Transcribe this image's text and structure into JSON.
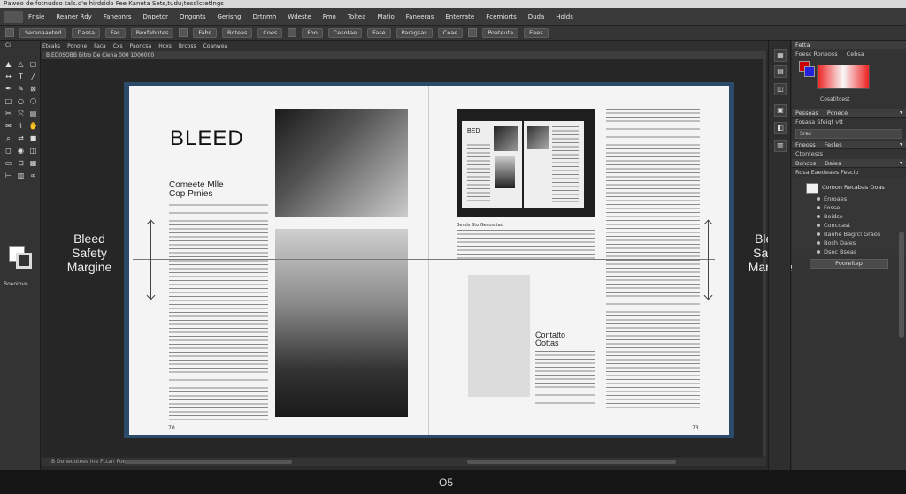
{
  "window": {
    "title": "Pаweo de fotnudso tals.o'e hirdsido Fee Kaneta Sets,tudu;tesdlctetlngs"
  },
  "menu": {
    "items": [
      "Fnsie",
      "Reaner Rdy",
      "Faneonrs",
      "Dnpetor",
      "Ongonts",
      "Gerisng",
      "Drtnmh",
      "Wdeste",
      "Fmo",
      "Toltea",
      "Matio",
      "Faneeras",
      "Enterrate",
      "Fcemiorts",
      "Duda",
      "Holds"
    ]
  },
  "options_bar": {
    "buttons": [
      "Serenaaeted",
      "Dassa",
      "Fas",
      "Bexfabntes",
      "Fabs",
      "Boteas",
      "Coes",
      "Foo",
      "Cesotae",
      "Fase",
      "Paregsas",
      "Ceae",
      "Poateuta",
      "Eees"
    ]
  },
  "control_bar": {
    "items": [
      "Eteaks",
      "Ponone",
      "Faca",
      "Cxs",
      "Paoncsa",
      "Hoxs",
      "Brcoss",
      "Coanwea"
    ]
  },
  "document_tab": {
    "label": "B ED0SOBB Bitro De Ciena 000 1000000"
  },
  "toolbox": {
    "top_label": "Ci",
    "bottom_label": "Boeoiove",
    "tool_icons": [
      "select-icon",
      "direct-select-icon",
      "page-icon",
      "gap-icon",
      "type-icon",
      "line-icon",
      "pen-icon",
      "pencil-icon",
      "frame-rect-icon",
      "rectangle-icon",
      "ellipse-icon",
      "polygon-icon",
      "scissors-icon",
      "transform-icon",
      "gradient-icon",
      "note-icon",
      "eyedropper-icon",
      "hand-icon",
      "zoom-icon",
      "swap-icon",
      "fill-icon",
      "stroke-icon",
      "preview-icon",
      "bleed-icon",
      "slug-icon",
      "frame-icon",
      "grid-icon",
      "measure-icon",
      "table-icon",
      "link-icon"
    ]
  },
  "spread": {
    "left_page": {
      "heading": "BLEED",
      "subhead_line1": "Comeete Mlle",
      "subhead_line2": "Cop Prnies",
      "page_number": "70"
    },
    "right_page": {
      "inset_title": "BED",
      "caption": "Bends Sto Gesosstad",
      "contact_line1": "Contatto",
      "contact_line2": "Oottas",
      "page_number": "73"
    }
  },
  "annotations": {
    "left_margin_label_line1": "Bleed",
    "left_margin_label_line2": "Safety",
    "left_margin_label_line3": "Margine",
    "right_margin_label_line1": "Bleed",
    "right_margin_label_line2": "Safety",
    "right_margin_label_line3": "Margine"
  },
  "scroll_status": {
    "label": "B Doneootees Ine Fctan Foee"
  },
  "panel_icons": [
    "layers-icon",
    "pages-icon",
    "links-icon",
    "stroke-icon",
    "color-icon",
    "swatches-icon"
  ],
  "panels": {
    "color_header": "Fetta",
    "color_tabs": [
      "Foesc Roneoss",
      "Cebsa"
    ],
    "color_label": "Cosatitcest",
    "stroke_header": "Pessoas",
    "stroke_sub": "Pcnece",
    "stroke_row": "Fosasa Sfeigt vtt",
    "input_placeholder": "Srac",
    "effects_header": "Fneoss",
    "effects_sub": "Fesles",
    "effects_row": "Ctontests",
    "layers_header": "Bcncos",
    "layers_sub": "Dales",
    "layers_tab": "Rosa  Eaedeaes  Fescip",
    "layer_name": "Comon Recabas Ooas",
    "layer_items": [
      "Enroaes",
      "Fosse",
      "Boidse",
      "Concoast",
      "Baohe Bagrcl Graos",
      "Bosh Daies",
      "Dsec Bseas"
    ],
    "action_button": "Pooreltep"
  },
  "taskbar": {
    "os_label": "O5"
  }
}
